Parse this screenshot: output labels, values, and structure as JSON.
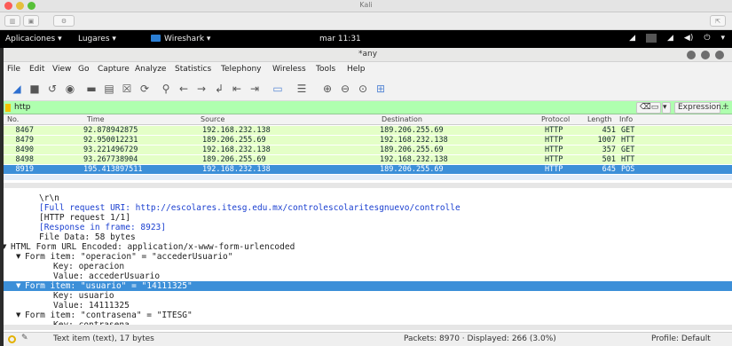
{
  "host": {
    "title": "Kali"
  },
  "panel": {
    "apps": "Aplicaciones ▾",
    "places": "Lugares ▾",
    "app": "Wireshark ▾",
    "clock": "mar 11:31"
  },
  "window": {
    "title": "*any"
  },
  "menu": [
    "File",
    "Edit",
    "View",
    "Go",
    "Capture",
    "Analyze",
    "Statistics",
    "Telephony",
    "Wireless",
    "Tools",
    "Help"
  ],
  "filter": {
    "value": "http",
    "expression": "Expression...",
    "plus": "+"
  },
  "packets": {
    "columns": {
      "no": "No.",
      "time": "Time",
      "source": "Source",
      "destination": "Destination",
      "protocol": "Protocol",
      "length": "Length",
      "info": "Info"
    },
    "rows": [
      {
        "no": "8467",
        "time": "92.878942875",
        "source": "192.168.232.138",
        "destination": "189.206.255.69",
        "protocol": "HTTP",
        "length": "451",
        "info": "GET"
      },
      {
        "no": "8479",
        "time": "92.950012231",
        "source": "189.206.255.69",
        "destination": "192.168.232.138",
        "protocol": "HTTP",
        "length": "1007",
        "info": "HTT"
      },
      {
        "no": "8490",
        "time": "93.221496729",
        "source": "192.168.232.138",
        "destination": "189.206.255.69",
        "protocol": "HTTP",
        "length": "357",
        "info": "GET"
      },
      {
        "no": "8498",
        "time": "93.267738904",
        "source": "189.206.255.69",
        "destination": "192.168.232.138",
        "protocol": "HTTP",
        "length": "501",
        "info": "HTT"
      },
      {
        "no": "8919",
        "time": "195.413897511",
        "source": "192.168.232.138",
        "destination": "189.206.255.69",
        "protocol": "HTTP",
        "length": "645",
        "info": "POS"
      }
    ]
  },
  "details": {
    "lines": [
      {
        "text": "\\r\\n",
        "indent": 2
      },
      {
        "text": "[Full request URI: http://escolares.itesg.edu.mx/controlescolaritesgnuevo/controlle",
        "indent": 2,
        "link": true
      },
      {
        "text": "[HTTP request 1/1]",
        "indent": 2
      },
      {
        "text": "[Response in frame: 8923]",
        "indent": 2,
        "link": true
      },
      {
        "text": "File Data: 58 bytes",
        "indent": 2
      },
      {
        "text": "HTML Form URL Encoded: application/x-www-form-urlencoded",
        "indent": 0,
        "arrow": "▼"
      },
      {
        "text": "Form item: \"operacion\" = \"accederUsuario\"",
        "indent": 1,
        "arrow": "▼"
      },
      {
        "text": "Key: operacion",
        "indent": 3
      },
      {
        "text": "Value: accederUsuario",
        "indent": 3
      },
      {
        "text": "Form item: \"usuario\" = \"14111325\"",
        "indent": 1,
        "arrow": "▼",
        "selected": true
      },
      {
        "text": "Key: usuario",
        "indent": 3
      },
      {
        "text": "Value: 14111325",
        "indent": 3
      },
      {
        "text": "Form item: \"contrasena\" = \"ITESG\"",
        "indent": 1,
        "arrow": "▼"
      },
      {
        "text": "Key: contrasena",
        "indent": 3
      }
    ]
  },
  "status": {
    "item": "Text item (text), 17 bytes",
    "packets": "Packets: 8970 · Displayed: 266 (3.0%)",
    "profile": "Profile: Default"
  },
  "colors": {
    "row_http": "#e4ffc7",
    "selected": "#3c8fd8",
    "filter_ok": "#afffaf",
    "link": "#1a3fd0"
  }
}
